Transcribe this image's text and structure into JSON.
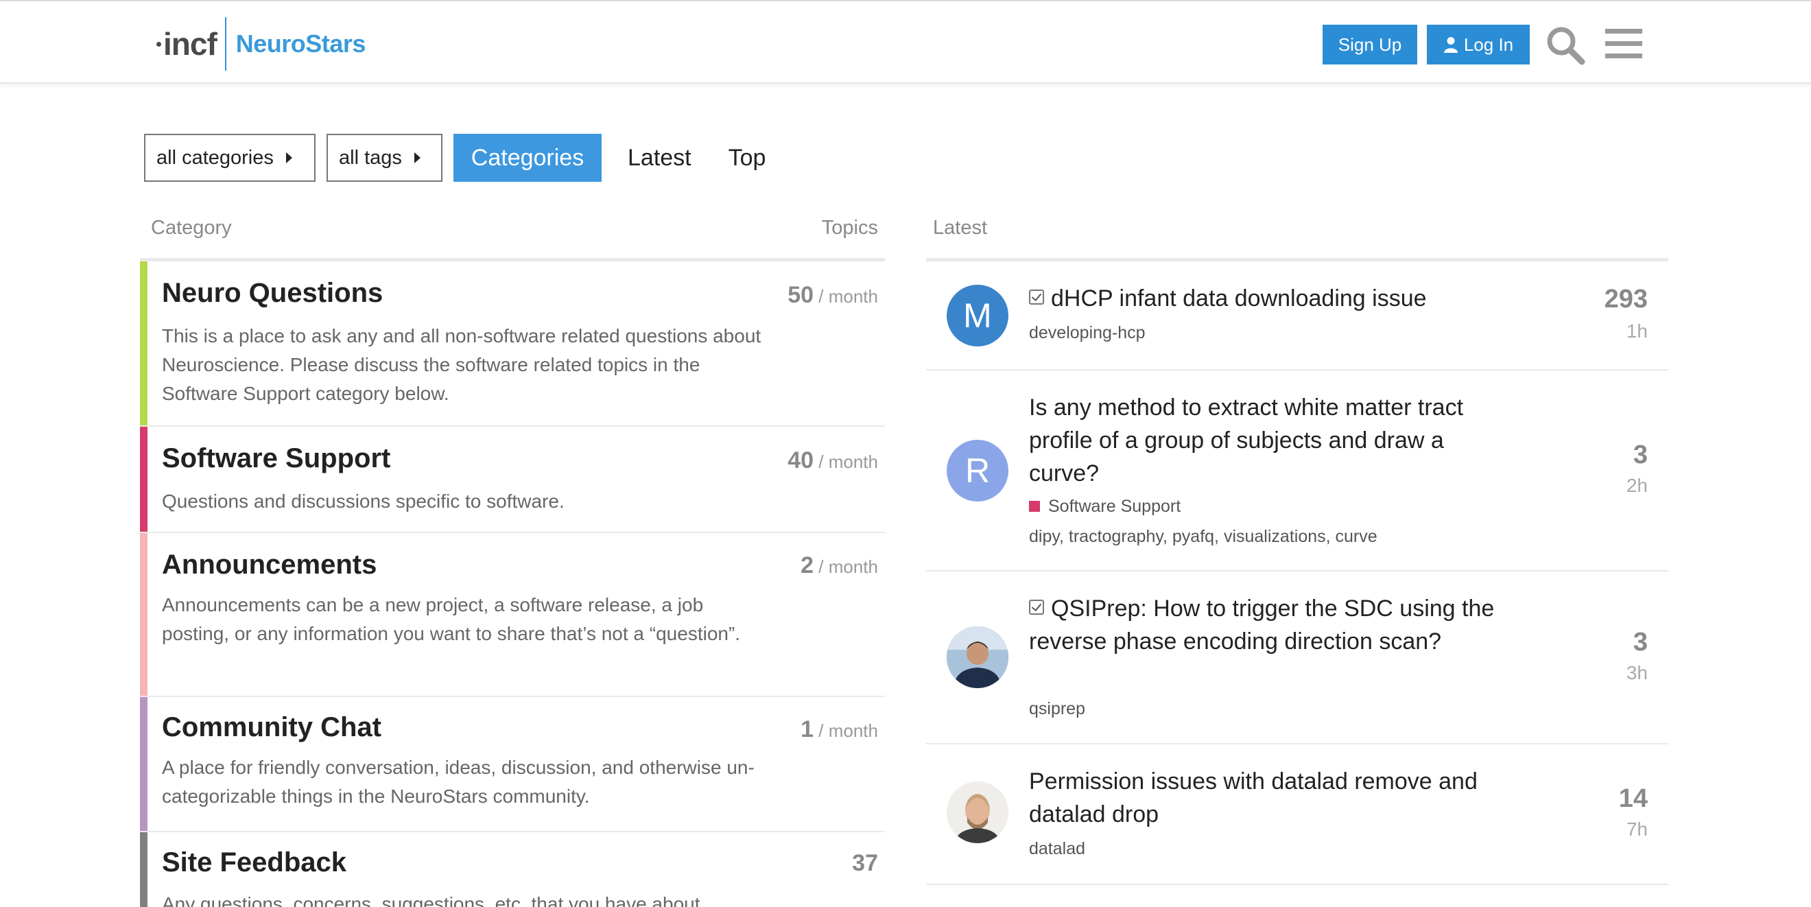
{
  "header": {
    "logo_incf": "incf",
    "logo_site": "NeuroStars",
    "signup_label": "Sign Up",
    "login_label": "Log In",
    "icons": [
      "user-icon",
      "search-icon",
      "hamburger-menu-icon"
    ]
  },
  "nav": {
    "all_categories": "all categories",
    "all_tags": "all tags",
    "tabs": [
      {
        "label": "Categories",
        "active": true
      },
      {
        "label": "Latest",
        "active": false
      },
      {
        "label": "Top",
        "active": false
      }
    ]
  },
  "categories": {
    "col_category": "Category",
    "col_topics": "Topics",
    "items": [
      {
        "title": "Neuro Questions",
        "description": "This is a place to ask any and all non-software related questions about Neuroscience. Please discuss the software related topics in the Software Support category below.",
        "count": "50",
        "period": "/ month",
        "color": "#b4d84a"
      },
      {
        "title": "Software Support",
        "description": "Questions and discussions specific to software.",
        "count": "40",
        "period": "/ month",
        "color": "#d63b6a"
      },
      {
        "title": "Announcements",
        "description": "Announcements can be a new project, a software release, a job posting, or any information you want to share that’s not a “question”.",
        "count": "2",
        "period": "/ month",
        "color": "#f6b4b4"
      },
      {
        "title": "Community Chat",
        "description": "A place for friendly conversation, ideas, discussion, and otherwise un-categorizable things in the NeuroStars community.",
        "count": "1",
        "period": "/ month",
        "color": "#b794c2"
      },
      {
        "title": "Site Feedback",
        "description": "Any questions, concerns, suggestions, etc. that you have about",
        "count": "37",
        "period": "",
        "color": "#808080"
      }
    ]
  },
  "latest": {
    "heading": "Latest",
    "items": [
      {
        "avatar_letter": "M",
        "avatar_color": "#3a84cc",
        "solved": true,
        "title": "dHCP infant data downloading issue",
        "category": "",
        "tags": "developing-hcp",
        "replies": "293",
        "age": "1h"
      },
      {
        "avatar_letter": "R",
        "avatar_color": "#8aa6e8",
        "solved": false,
        "title": "Is any method to extract white matter tract profile of a group of subjects and draw a curve?",
        "category": "Software Support",
        "tags": "dipy, tractography, pyafq, visualizations, curve",
        "replies": "3",
        "age": "2h"
      },
      {
        "avatar_letter": "",
        "avatar_color": "#5b7fa8",
        "solved": true,
        "title": "QSIPrep: How to trigger the SDC using the reverse phase encoding direction scan?",
        "category": "",
        "tags": "qsiprep",
        "replies": "3",
        "age": "3h"
      },
      {
        "avatar_letter": "",
        "avatar_color": "#c9a58a",
        "solved": false,
        "title": "Permission issues with datalad remove and datalad drop",
        "category": "",
        "tags": "datalad",
        "replies": "14",
        "age": "7h"
      }
    ]
  },
  "colors": {
    "primary_button": "#2b8dd6",
    "active_tab": "#3d98e0",
    "brand": "#3a9ad9"
  }
}
